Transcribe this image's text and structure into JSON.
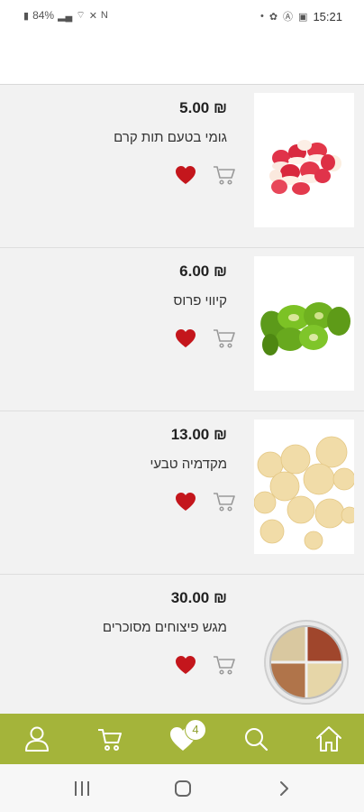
{
  "status_bar": {
    "battery": "84%",
    "time": "15:21"
  },
  "products": [
    {
      "price": "5.00 ₪",
      "name": "גומי בטעם תות קרם",
      "image": "strawberry-cream-gummies"
    },
    {
      "price": "6.00 ₪",
      "name": "קיווי פרוס",
      "image": "dried-kiwi-slices"
    },
    {
      "price": "13.00 ₪",
      "name": "מקדמיה טבעי",
      "image": "macadamia-nuts"
    },
    {
      "price": "30.00 ₪",
      "name": "מגש פיצוחים מסוכרים",
      "image": "sugared-nut-tray"
    }
  ],
  "bottom_nav": {
    "items": [
      "user-icon",
      "cart-icon",
      "favorites-icon",
      "search-icon",
      "home-icon"
    ],
    "favorites_count": "4"
  },
  "colors": {
    "accent": "#a4b43a",
    "heart": "#c4161c",
    "list_bg": "#f2f2f2"
  }
}
